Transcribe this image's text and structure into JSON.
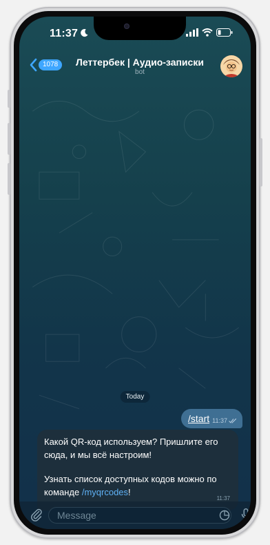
{
  "status_bar": {
    "time": "11:37"
  },
  "header": {
    "back_count": "1078",
    "title": "Леттербек | Аудио-записки",
    "subtitle": "bot"
  },
  "chat": {
    "date_label": "Today",
    "outgoing": {
      "text": "/start",
      "time": "11:37"
    },
    "incoming": {
      "line1": "Какой QR-код используем? Пришлите его сюда, и мы всё настроим!",
      "line2_prefix": "Узнать список доступных кодов можно по команде ",
      "line2_link": "/myqrcodes",
      "line2_suffix": "!",
      "time": "11:37"
    }
  },
  "composer": {
    "placeholder": "Message"
  },
  "icons": {
    "moon": "moon-icon",
    "signal": "cellular-signal-icon",
    "wifi": "wifi-icon",
    "battery": "battery-icon",
    "back": "chevron-left-icon",
    "attach": "paperclip-icon",
    "sticker": "sticker-icon",
    "mic": "microphone-icon",
    "read": "double-check-icon"
  },
  "colors": {
    "accent": "#3ea6ff",
    "outgoing_bubble": "#3f6f93",
    "incoming_bubble": "#1d2f3c",
    "link": "#5fb1f5"
  }
}
